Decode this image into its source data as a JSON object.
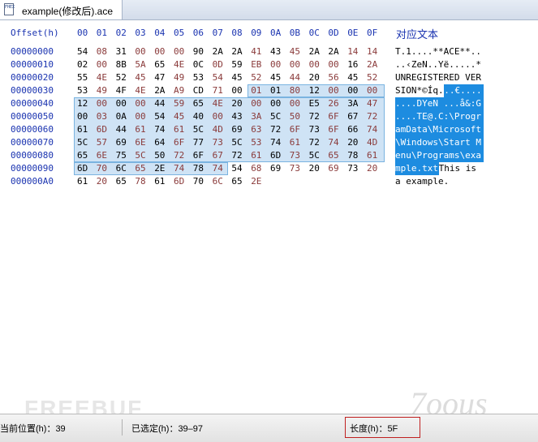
{
  "tab": {
    "icon_text": "FHEX",
    "title": "example(修改后).ace"
  },
  "header": {
    "offset_label": "Offset(h)",
    "columns": [
      "00",
      "01",
      "02",
      "03",
      "04",
      "05",
      "06",
      "07",
      "08",
      "09",
      "0A",
      "0B",
      "0C",
      "0D",
      "0E",
      "0F"
    ],
    "text_label": "对应文本"
  },
  "rows": [
    {
      "offset": "00000000",
      "bytes": [
        "54",
        "08",
        "31",
        "00",
        "00",
        "00",
        "90",
        "2A",
        "2A",
        "41",
        "43",
        "45",
        "2A",
        "2A",
        "14",
        "14"
      ],
      "colors": [
        0,
        1,
        0,
        1,
        1,
        1,
        0,
        0,
        0,
        1,
        0,
        1,
        0,
        0,
        1,
        1
      ],
      "text": "T.1....**ACE**.."
    },
    {
      "offset": "00000010",
      "bytes": [
        "02",
        "00",
        "8B",
        "5A",
        "65",
        "4E",
        "0C",
        "0D",
        "59",
        "EB",
        "00",
        "00",
        "00",
        "00",
        "16",
        "2A"
      ],
      "colors": [
        0,
        1,
        0,
        1,
        0,
        1,
        0,
        1,
        0,
        1,
        1,
        1,
        1,
        1,
        0,
        1
      ],
      "text": "..‹ZeN..Yë.....*"
    },
    {
      "offset": "00000020",
      "bytes": [
        "55",
        "4E",
        "52",
        "45",
        "47",
        "49",
        "53",
        "54",
        "45",
        "52",
        "45",
        "44",
        "20",
        "56",
        "45",
        "52"
      ],
      "colors": [
        0,
        1,
        0,
        1,
        0,
        1,
        0,
        1,
        0,
        1,
        0,
        1,
        0,
        1,
        0,
        1
      ],
      "text": "UNREGISTERED VER"
    },
    {
      "offset": "00000030",
      "bytes": [
        "53",
        "49",
        "4F",
        "4E",
        "2A",
        "A9",
        "CD",
        "71",
        "00",
        "01",
        "01",
        "80",
        "12",
        "00",
        "00",
        "00"
      ],
      "colors": [
        0,
        1,
        0,
        1,
        0,
        1,
        0,
        1,
        0,
        1,
        0,
        1,
        0,
        1,
        0,
        1
      ],
      "text_plain": "SION*©Íq.",
      "text_sel": "..€....."
    },
    {
      "offset": "00000040",
      "bytes": [
        "12",
        "00",
        "00",
        "00",
        "44",
        "59",
        "65",
        "4E",
        "20",
        "00",
        "00",
        "00",
        "E5",
        "26",
        "3A",
        "47"
      ],
      "colors": [
        0,
        1,
        0,
        1,
        0,
        1,
        0,
        1,
        0,
        1,
        0,
        1,
        0,
        1,
        0,
        1
      ],
      "text_sel": "....DYeN ...å&:G"
    },
    {
      "offset": "00000050",
      "bytes": [
        "00",
        "03",
        "0A",
        "00",
        "54",
        "45",
        "40",
        "00",
        "43",
        "3A",
        "5C",
        "50",
        "72",
        "6F",
        "67",
        "72"
      ],
      "colors": [
        0,
        1,
        0,
        1,
        0,
        1,
        0,
        1,
        0,
        1,
        0,
        1,
        0,
        1,
        0,
        1
      ],
      "text_sel": "....TE@.C:\\Progr"
    },
    {
      "offset": "00000060",
      "bytes": [
        "61",
        "6D",
        "44",
        "61",
        "74",
        "61",
        "5C",
        "4D",
        "69",
        "63",
        "72",
        "6F",
        "73",
        "6F",
        "66",
        "74"
      ],
      "colors": [
        0,
        1,
        0,
        1,
        0,
        1,
        0,
        1,
        0,
        1,
        0,
        1,
        0,
        1,
        0,
        1
      ],
      "text_sel": "amData\\Microsoft"
    },
    {
      "offset": "00000070",
      "bytes": [
        "5C",
        "57",
        "69",
        "6E",
        "64",
        "6F",
        "77",
        "73",
        "5C",
        "53",
        "74",
        "61",
        "72",
        "74",
        "20",
        "4D"
      ],
      "colors": [
        0,
        1,
        0,
        1,
        0,
        1,
        0,
        1,
        0,
        1,
        0,
        1,
        0,
        1,
        0,
        1
      ],
      "text_sel": "\\Windows\\Start M"
    },
    {
      "offset": "00000080",
      "bytes": [
        "65",
        "6E",
        "75",
        "5C",
        "50",
        "72",
        "6F",
        "67",
        "72",
        "61",
        "6D",
        "73",
        "5C",
        "65",
        "78",
        "61"
      ],
      "colors": [
        0,
        1,
        0,
        1,
        0,
        1,
        0,
        1,
        0,
        1,
        0,
        1,
        0,
        1,
        0,
        1
      ],
      "text_sel": "enu\\Programs\\exa"
    },
    {
      "offset": "00000090",
      "bytes": [
        "6D",
        "70",
        "6C",
        "65",
        "2E",
        "74",
        "78",
        "74",
        "54",
        "68",
        "69",
        "73",
        "20",
        "69",
        "73",
        "20"
      ],
      "colors": [
        0,
        1,
        0,
        1,
        0,
        1,
        0,
        1,
        0,
        1,
        0,
        1,
        0,
        1,
        0,
        1
      ],
      "text_sel": "mple.txt",
      "text_plain": "This is "
    },
    {
      "offset": "000000A0",
      "bytes": [
        "61",
        "20",
        "65",
        "78",
        "61",
        "6D",
        "70",
        "6C",
        "65",
        "2E"
      ],
      "colors": [
        0,
        1,
        0,
        1,
        0,
        1,
        0,
        1,
        0,
        1
      ],
      "text": "a example."
    }
  ],
  "statusbar": {
    "position": "当前位置(h)：39",
    "selection": "已选定(h)：39–97",
    "length": "长度(h)：5F"
  },
  "colors": {
    "accent": "#1a33b0",
    "odd_byte": "#8a3a3a",
    "selection_fill": "#cfe3f5",
    "selection_text_fill": "#1d8ce0",
    "length_highlight": "#c02020"
  },
  "watermarks": {
    "left": "FREEBUF",
    "right": "7oous"
  }
}
